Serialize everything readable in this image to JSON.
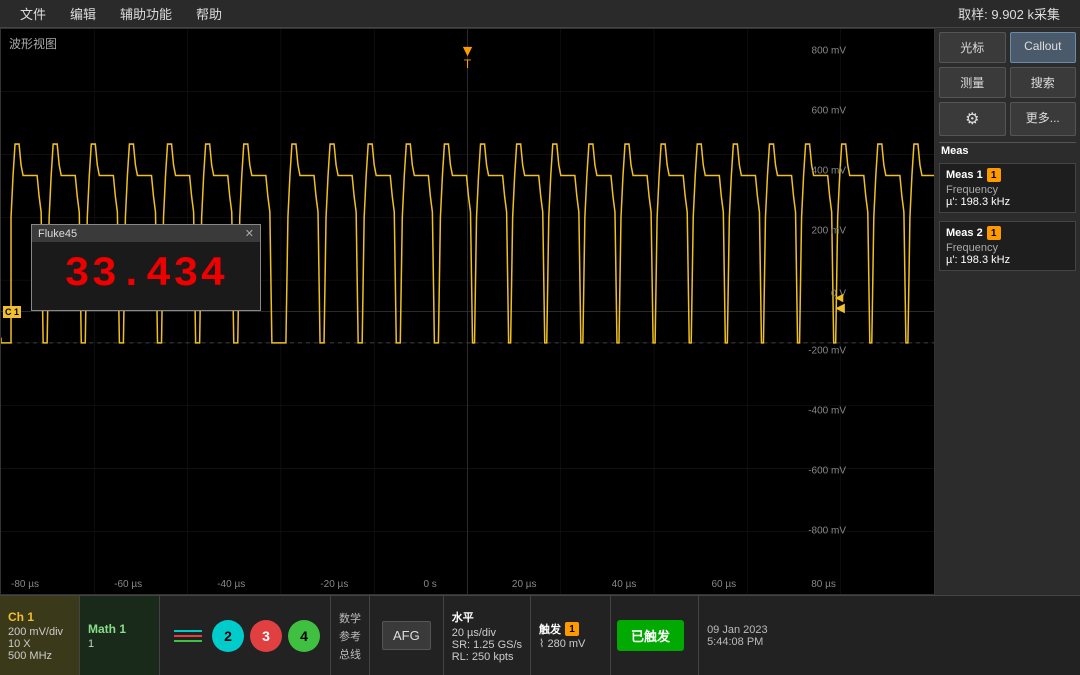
{
  "menu": {
    "items": [
      "文件",
      "编辑",
      "辅助功能",
      "帮助"
    ],
    "sample_info": "取样: 9.902 k采集"
  },
  "waveform": {
    "title": "波形视图",
    "volt_labels": [
      "800 mV",
      "600 mV",
      "400 mV",
      "200 mV",
      "0 V",
      "-200 mV",
      "-400 mV",
      "-600 mV",
      "-800 mV"
    ],
    "time_labels": [
      "-80 µs",
      "-60 µs",
      "-40 µs",
      "-20 µs",
      "0 s",
      "20 µs",
      "40 µs",
      "60 µs",
      "80 µs"
    ],
    "ch1_marker": "C 1",
    "right_arrow": "◄"
  },
  "fluke": {
    "title": "Fluke45",
    "close": "✕",
    "value": "33.434"
  },
  "right_panel": {
    "btn1": "光标",
    "btn2": "Callout",
    "btn3": "测量",
    "btn4": "搜索",
    "btn5_icon": "⚙",
    "btn6": "更多...",
    "meas1": {
      "title": "Meas 1",
      "badge": "1",
      "label": "Frequency",
      "value": "µ': 198.3 kHz"
    },
    "meas2": {
      "title": "Meas 2",
      "badge": "1",
      "label": "Frequency",
      "value": "µ': 198.3 kHz"
    }
  },
  "bottom": {
    "ch1": {
      "label": "Ch 1",
      "line1": "200 mV/div",
      "line2": "10 X",
      "line3": "500 MHz"
    },
    "math": {
      "label": "Math 1",
      "line1": "1"
    },
    "ch_buttons": [
      "2",
      "3",
      "4"
    ],
    "afg": "AFG",
    "math_ref": {
      "line1": "数学",
      "line2": "参考",
      "line3": "总线"
    },
    "horizontal": {
      "label": "水平",
      "line1": "20 µs/div",
      "line2": "SR: 1.25 GS/s",
      "line3": "RL: 250 kpts"
    },
    "trigger": {
      "label": "触发",
      "badge": "1",
      "icon": "⌇",
      "value": "280 mV"
    },
    "triggered": "已触发",
    "datetime": {
      "line1": "09 Jan 2023",
      "line2": "5:44:08 PM"
    }
  }
}
